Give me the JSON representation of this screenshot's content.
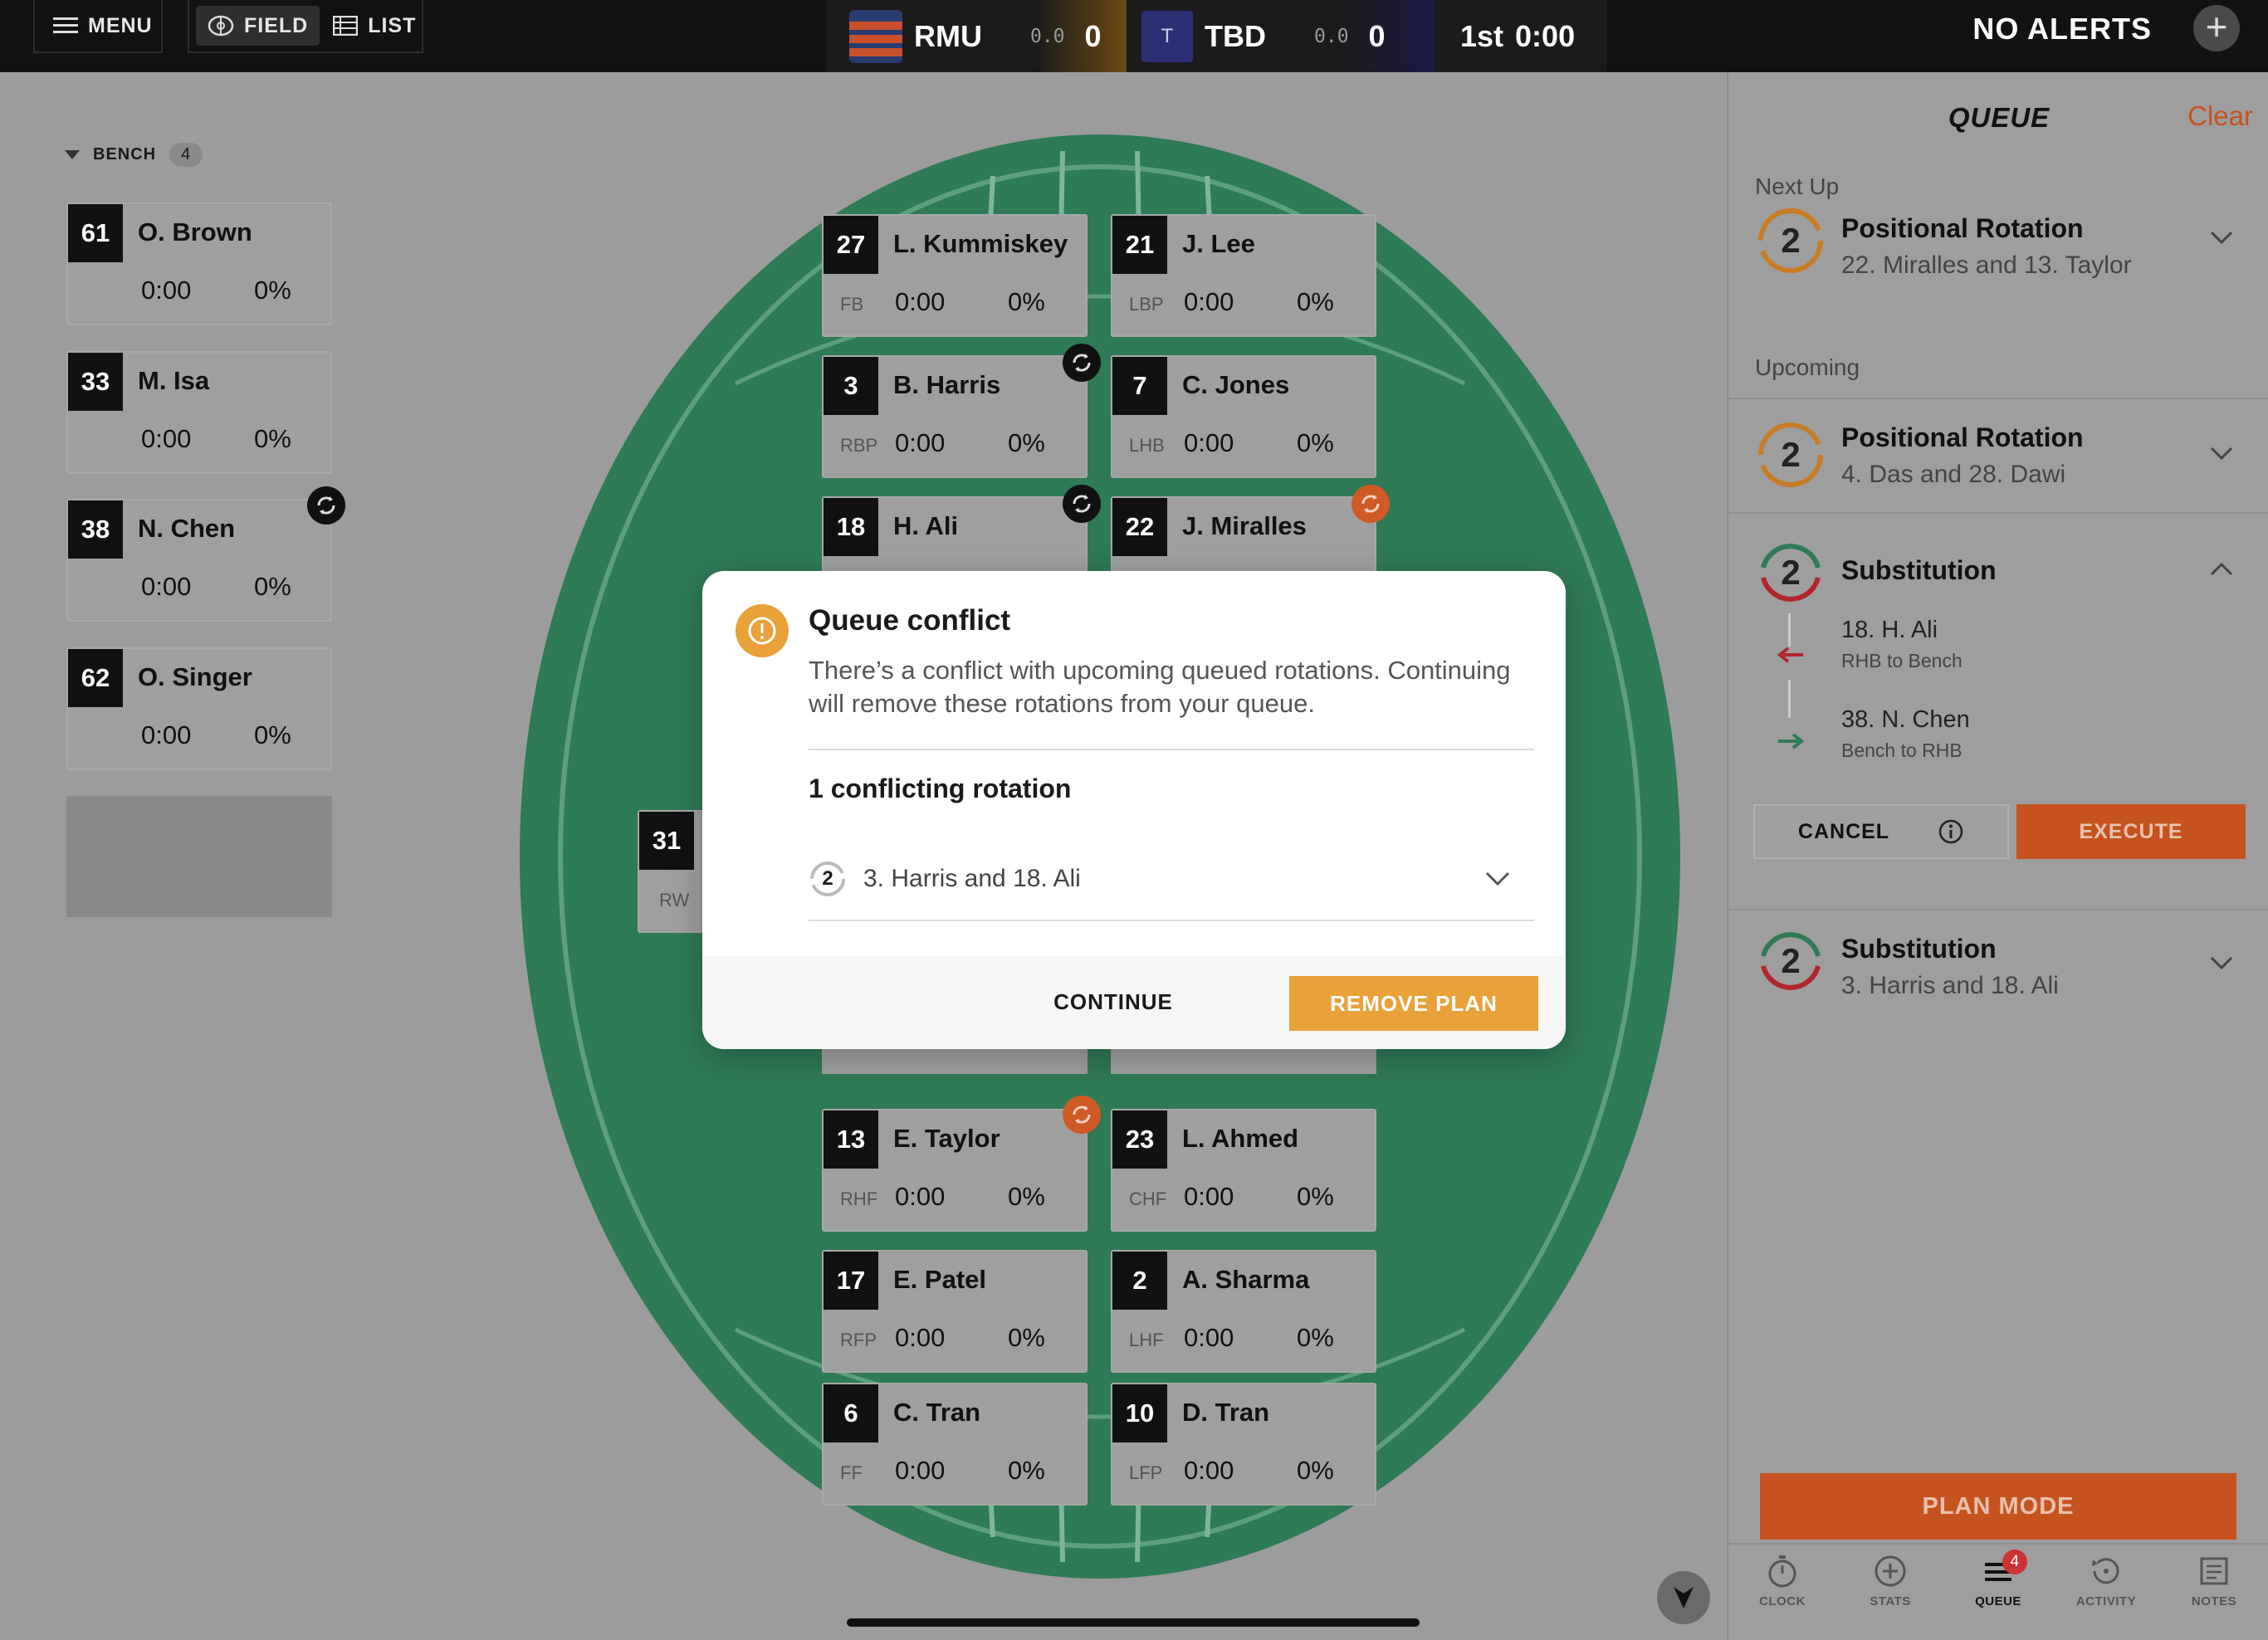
{
  "topbar": {
    "menu_label": "MENU",
    "field_label": "FIELD",
    "list_label": "LIST",
    "home": {
      "name": "RMU",
      "sub": "0.0",
      "score": "0"
    },
    "away": {
      "badge": "T",
      "name": "TBD",
      "sub": "0.0",
      "score": "0"
    },
    "period": "1st",
    "clock": "0:00",
    "alerts": "NO ALERTS",
    "add": "+"
  },
  "bench": {
    "label": "BENCH",
    "count": "4",
    "players": [
      {
        "num": "61",
        "name": "O. Brown",
        "time": "0:00",
        "pct": "0%"
      },
      {
        "num": "33",
        "name": "M. Isa",
        "time": "0:00",
        "pct": "0%"
      },
      {
        "num": "38",
        "name": "N. Chen",
        "time": "0:00",
        "pct": "0%"
      },
      {
        "num": "62",
        "name": "O. Singer",
        "time": "0:00",
        "pct": "0%"
      }
    ]
  },
  "field_players": {
    "p27": {
      "num": "27",
      "name": "L. Kummiskey",
      "pos": "FB",
      "time": "0:00",
      "pct": "0%"
    },
    "p21": {
      "num": "21",
      "name": "J. Lee",
      "pos": "LBP",
      "time": "0:00",
      "pct": "0%"
    },
    "p3": {
      "num": "3",
      "name": "B. Harris",
      "pos": "RBP",
      "time": "0:00",
      "pct": "0%"
    },
    "p7": {
      "num": "7",
      "name": "C. Jones",
      "pos": "LHB",
      "time": "0:00",
      "pct": "0%"
    },
    "p18": {
      "num": "18",
      "name": "H. Ali"
    },
    "p22": {
      "num": "22",
      "name": "J. Miralles"
    },
    "p31": {
      "num": "31",
      "pos": "RW"
    },
    "p13": {
      "num": "13",
      "name": "E. Taylor",
      "pos": "RHF",
      "time": "0:00",
      "pct": "0%"
    },
    "p23": {
      "num": "23",
      "name": "L. Ahmed",
      "pos": "CHF",
      "time": "0:00",
      "pct": "0%"
    },
    "p17": {
      "num": "17",
      "name": "E. Patel",
      "pos": "RFP",
      "time": "0:00",
      "pct": "0%"
    },
    "p2": {
      "num": "2",
      "name": "A. Sharma",
      "pos": "LHF",
      "time": "0:00",
      "pct": "0%"
    },
    "p6": {
      "num": "6",
      "name": "C. Tran",
      "pos": "FF",
      "time": "0:00",
      "pct": "0%"
    },
    "p10": {
      "num": "10",
      "name": "D. Tran",
      "pos": "LFP",
      "time": "0:00",
      "pct": "0%"
    }
  },
  "modal": {
    "title": "Queue conflict",
    "body": "There’s a conflict with upcoming queued rotations. Continuing will remove these rotations from your queue.",
    "count_label": "1 conflicting rotation",
    "item_badge": "2",
    "item_label": "3. Harris and 18. Ali",
    "continue_label": "CONTINUE",
    "remove_label": "REMOVE PLAN"
  },
  "queue": {
    "title": "QUEUE",
    "clear": "Clear",
    "next_up_label": "Next Up",
    "upcoming_label": "Upcoming",
    "next": {
      "badge": "2",
      "title": "Positional Rotation",
      "sub": "22. Miralles and 13. Taylor"
    },
    "upcoming1": {
      "badge": "2",
      "title": "Positional Rotation",
      "sub": "4. Das and 28. Dawi"
    },
    "upcoming2": {
      "badge": "2",
      "title": "Substitution",
      "off_name": "18. H. Ali",
      "off_desc": "RHB to Bench",
      "on_name": "38. N. Chen",
      "on_desc": "Bench to RHB",
      "cancel_label": "CANCEL",
      "execute_label": "EXECUTE"
    },
    "upcoming3": {
      "badge": "2",
      "title": "Substitution",
      "sub": "3. Harris and 18. Ali"
    },
    "plan_mode": "PLAN MODE"
  },
  "tabs": [
    {
      "label": "CLOCK",
      "icon": "stopwatch-icon"
    },
    {
      "label": "STATS",
      "icon": "plus-circle-icon"
    },
    {
      "label": "QUEUE",
      "icon": "queue-list-icon",
      "badge": "4"
    },
    {
      "label": "ACTIVITY",
      "icon": "history-icon"
    },
    {
      "label": "NOTES",
      "icon": "notes-icon"
    }
  ],
  "colors": {
    "accent": "#c6531f",
    "modal_accent": "#e9a13a",
    "field": "#2f7a57"
  }
}
